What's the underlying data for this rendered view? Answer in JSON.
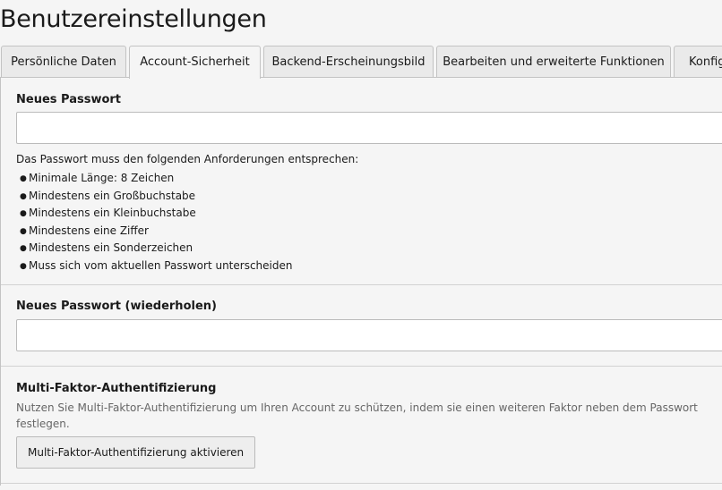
{
  "page": {
    "title": "Benutzereinstellungen"
  },
  "tabs": [
    {
      "label": "Persönliche Daten",
      "active": false
    },
    {
      "label": "Account-Sicherheit",
      "active": true
    },
    {
      "label": "Backend-Erscheinungsbild",
      "active": false
    },
    {
      "label": "Bearbeiten und erweiterte Funktionen",
      "active": false
    },
    {
      "label": "Konfig",
      "active": false
    }
  ],
  "password": {
    "label": "Neues Passwort",
    "value": "",
    "requirements_intro": "Das Passwort muss den folgenden Anforderungen entsprechen:",
    "requirements": [
      "Minimale Länge: 8 Zeichen",
      "Mindestens ein Großbuchstabe",
      "Mindestens ein Kleinbuchstabe",
      "Mindestens eine Ziffer",
      "Mindestens ein Sonderzeichen",
      "Muss sich vom aktuellen Passwort unterscheiden"
    ]
  },
  "password_repeat": {
    "label": "Neues Passwort (wiederholen)",
    "value": ""
  },
  "mfa": {
    "title": "Multi-Faktor-Authentifizierung",
    "description": "Nutzen Sie Multi-Faktor-Authentifizierung um Ihren Account zu schützen, indem sie einen weiteren Faktor neben dem Passwort festlegen.",
    "button_label": "Multi-Faktor-Authentifizierung aktivieren"
  },
  "colors": {
    "background": "#f5f5f5",
    "tab_inactive": "#eaeaea",
    "border": "#c3c3c3",
    "muted_text": "#666666"
  }
}
